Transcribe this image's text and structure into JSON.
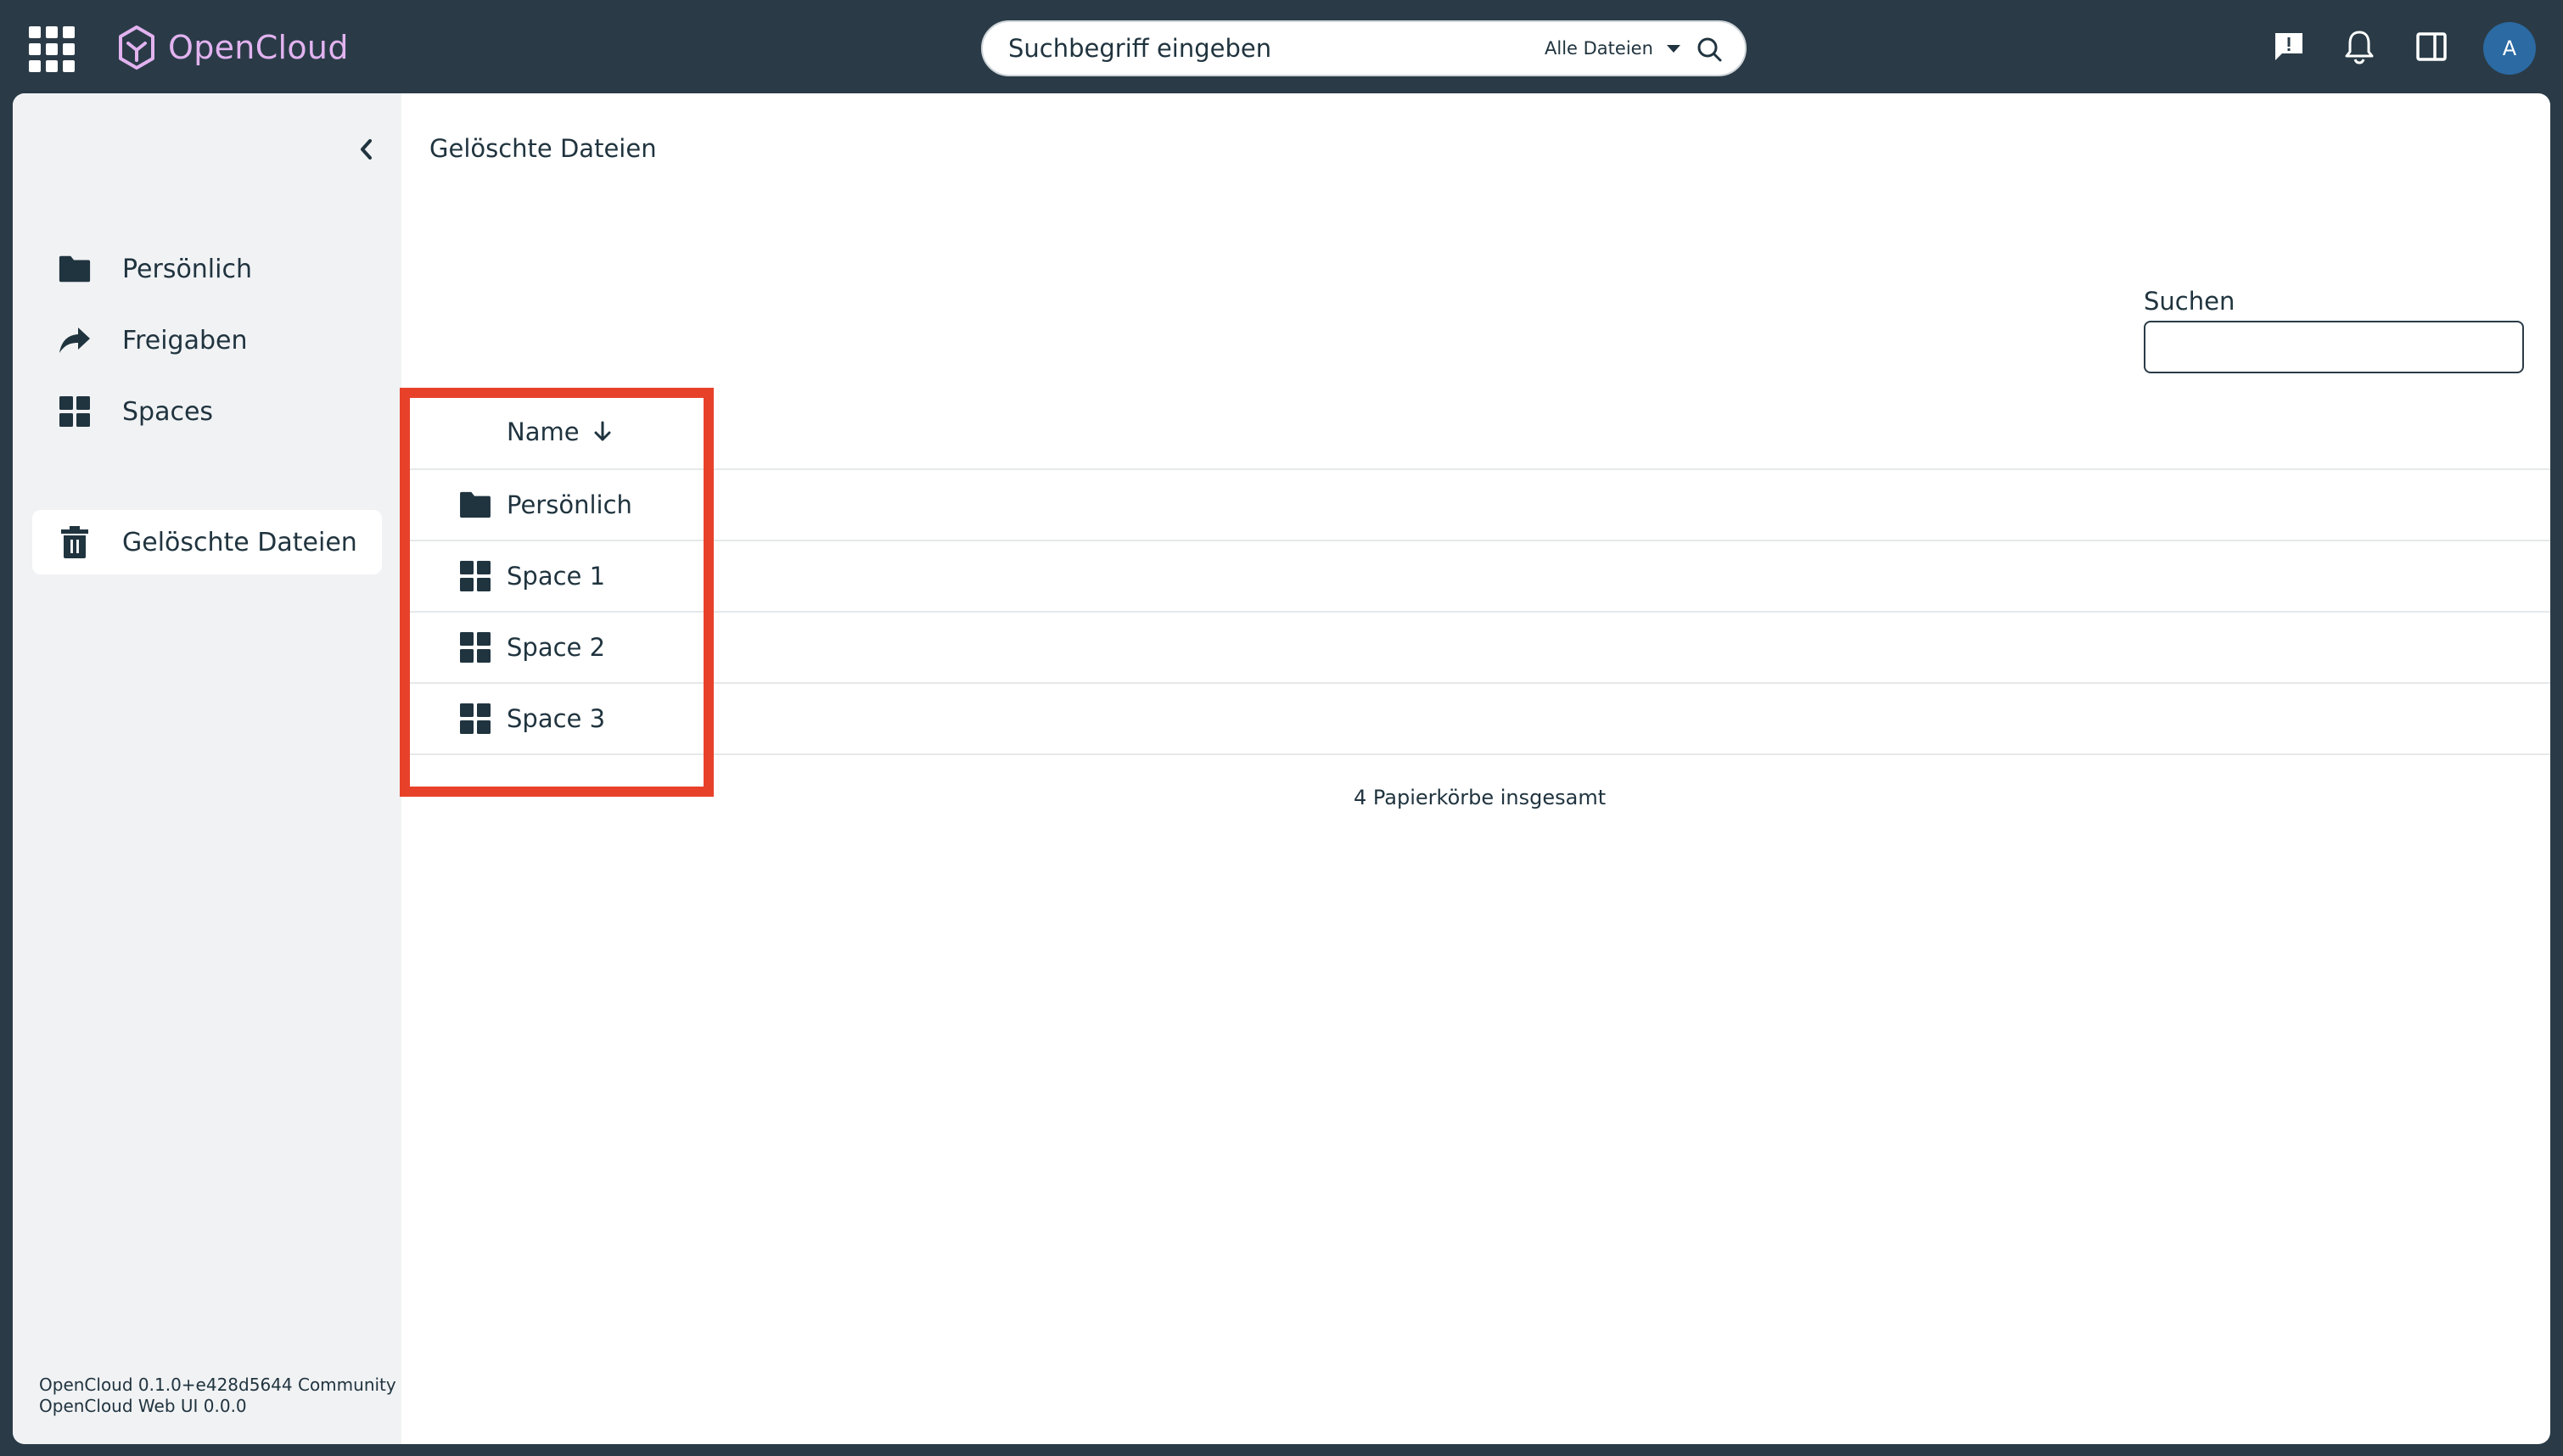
{
  "brand": {
    "name": "OpenCloud",
    "accent": "#e2b3f0"
  },
  "search": {
    "placeholder": "Suchbegriff eingeben",
    "scope": "Alle Dateien"
  },
  "header_icons": [
    "feedback-icon",
    "bell-icon",
    "sidebar-toggle-icon"
  ],
  "user": {
    "initial": "A",
    "color": "#2b6aa3"
  },
  "sidebar": {
    "items": [
      {
        "label": "Persönlich",
        "icon": "folder-icon",
        "active": false
      },
      {
        "label": "Freigaben",
        "icon": "share-icon",
        "active": false
      },
      {
        "label": "Spaces",
        "icon": "spaces-grid-icon",
        "active": false
      },
      {
        "label": "Gelöschte Dateien",
        "icon": "trash-icon",
        "active": true
      }
    ],
    "version_line1": "OpenCloud 0.1.0+e428d5644 Community",
    "version_line2": "OpenCloud Web UI 0.0.0"
  },
  "main": {
    "breadcrumb": "Gelöschte Dateien",
    "filter_label": "Suchen",
    "filter_value": "",
    "table": {
      "column_name": "Name",
      "sort": "descending-arrow",
      "rows": [
        {
          "label": "Persönlich",
          "icon": "folder-icon"
        },
        {
          "label": "Space 1",
          "icon": "spaces-grid-icon"
        },
        {
          "label": "Space 2",
          "icon": "spaces-grid-icon"
        },
        {
          "label": "Space 3",
          "icon": "spaces-grid-icon"
        }
      ]
    },
    "footer_count": "4 Papierkörbe insgesamt"
  },
  "highlight_color": "#e8412a"
}
